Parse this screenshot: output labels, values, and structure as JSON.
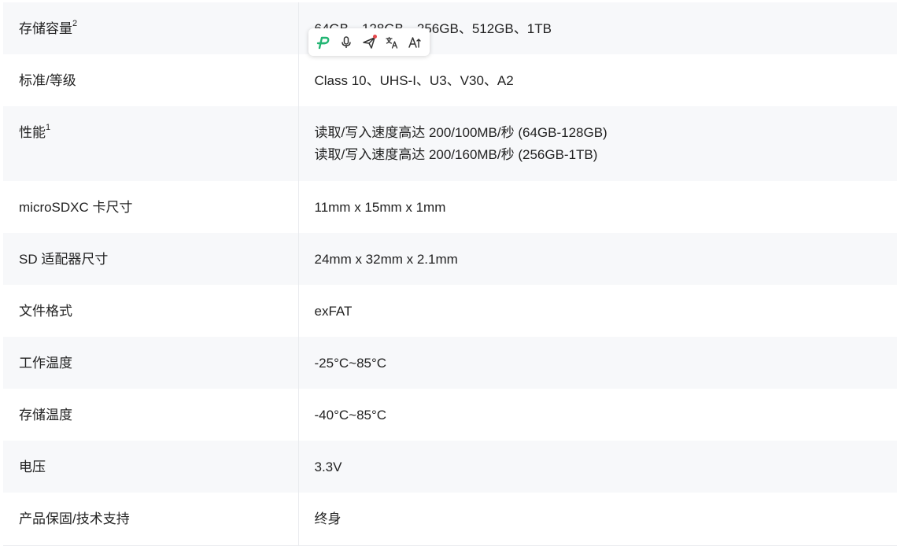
{
  "specs": [
    {
      "label": "存储容量",
      "sup": "2",
      "values": [
        "64GB、128GB、256GB、512GB、1TB"
      ]
    },
    {
      "label": "标准/等级",
      "sup": "",
      "values": [
        "Class 10、UHS-I、U3、V30、A2"
      ]
    },
    {
      "label": "性能",
      "sup": "1",
      "values": [
        "读取/写入速度高达 200/100MB/秒 (64GB-128GB)",
        "读取/写入速度高达 200/160MB/秒 (256GB-1TB)"
      ]
    },
    {
      "label": "microSDXC 卡尺寸",
      "sup": "",
      "values": [
        "11mm x 15mm x 1mm"
      ]
    },
    {
      "label": "SD 适配器尺寸",
      "sup": "",
      "values": [
        "24mm x 32mm x 2.1mm"
      ]
    },
    {
      "label": "文件格式",
      "sup": "",
      "values": [
        "exFAT"
      ]
    },
    {
      "label": "工作温度",
      "sup": "",
      "values": [
        "-25°C~85°C"
      ]
    },
    {
      "label": "存储温度",
      "sup": "",
      "values": [
        "-40°C~85°C"
      ]
    },
    {
      "label": "电压",
      "sup": "",
      "values": [
        "3.3V"
      ]
    },
    {
      "label": "产品保固/技术支持",
      "sup": "",
      "values": [
        "终身"
      ]
    }
  ],
  "toolbar": {
    "buttons": [
      {
        "icon": "assistant-logo-icon",
        "color": "#22b573"
      },
      {
        "icon": "microphone-icon",
        "color": "#333333"
      },
      {
        "icon": "send-icon",
        "color": "#333333",
        "notification": true
      },
      {
        "icon": "translate-icon",
        "color": "#333333"
      },
      {
        "icon": "text-size-icon",
        "color": "#333333"
      }
    ]
  },
  "colors": {
    "row_alt_bg": "#f7f8fa",
    "border": "#e9ebee",
    "text": "#222222",
    "accent": "#22b573",
    "notification_dot": "#e5484d"
  }
}
